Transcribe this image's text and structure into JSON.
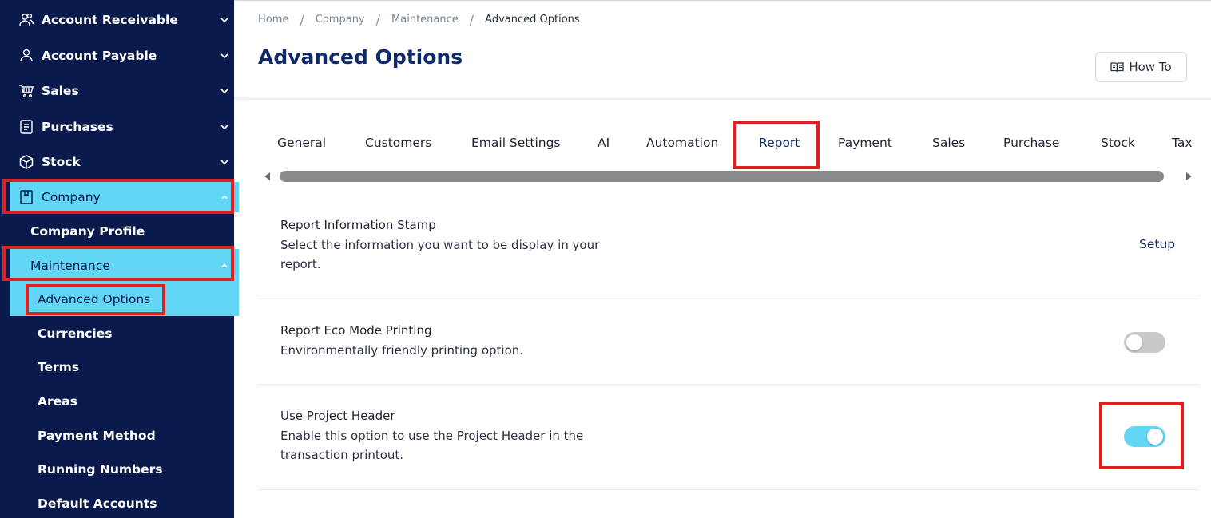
{
  "sidebar": {
    "items": [
      {
        "label": "Account Receivable",
        "icon": "users-icon"
      },
      {
        "label": "Account Payable",
        "icon": "user-icon"
      },
      {
        "label": "Sales",
        "icon": "cart-icon"
      },
      {
        "label": "Purchases",
        "icon": "receipt-icon"
      },
      {
        "label": "Stock",
        "icon": "box-icon"
      },
      {
        "label": "Company",
        "icon": "bookmark-icon"
      }
    ],
    "company_children": [
      {
        "label": "Company Profile"
      },
      {
        "label": "Maintenance"
      }
    ],
    "maintenance_children": [
      {
        "label": "Advanced Options"
      },
      {
        "label": "Currencies"
      },
      {
        "label": "Terms"
      },
      {
        "label": "Areas"
      },
      {
        "label": "Payment Method"
      },
      {
        "label": "Running Numbers"
      },
      {
        "label": "Default Accounts"
      }
    ],
    "active_section": "Company",
    "active_subsection": "Maintenance",
    "active_item": "Advanced Options"
  },
  "breadcrumb": [
    "Home",
    "Company",
    "Maintenance",
    "Advanced Options"
  ],
  "page_title": "Advanced Options",
  "howto_label": "How To",
  "tabs": [
    "General",
    "Customers",
    "Email Settings",
    "AI",
    "Automation",
    "Report",
    "Payment",
    "Sales",
    "Purchase",
    "Stock",
    "Tax"
  ],
  "active_tab": "Report",
  "settings": [
    {
      "title": "Report Information Stamp",
      "description": "Select the information you want to be display in your report.",
      "action_label": "Setup"
    },
    {
      "title": "Report Eco Mode Printing",
      "description": "Environmentally friendly printing option.",
      "enabled": false
    },
    {
      "title": "Use Project Header",
      "description": "Enable this option to use the Project Header in the transaction printout.",
      "enabled": true
    }
  ],
  "colors": {
    "sidebar_bg": "#0b1a4c",
    "active_bg": "#62d6f5",
    "title": "#0f2a6b",
    "highlight": "#e11f1f"
  }
}
